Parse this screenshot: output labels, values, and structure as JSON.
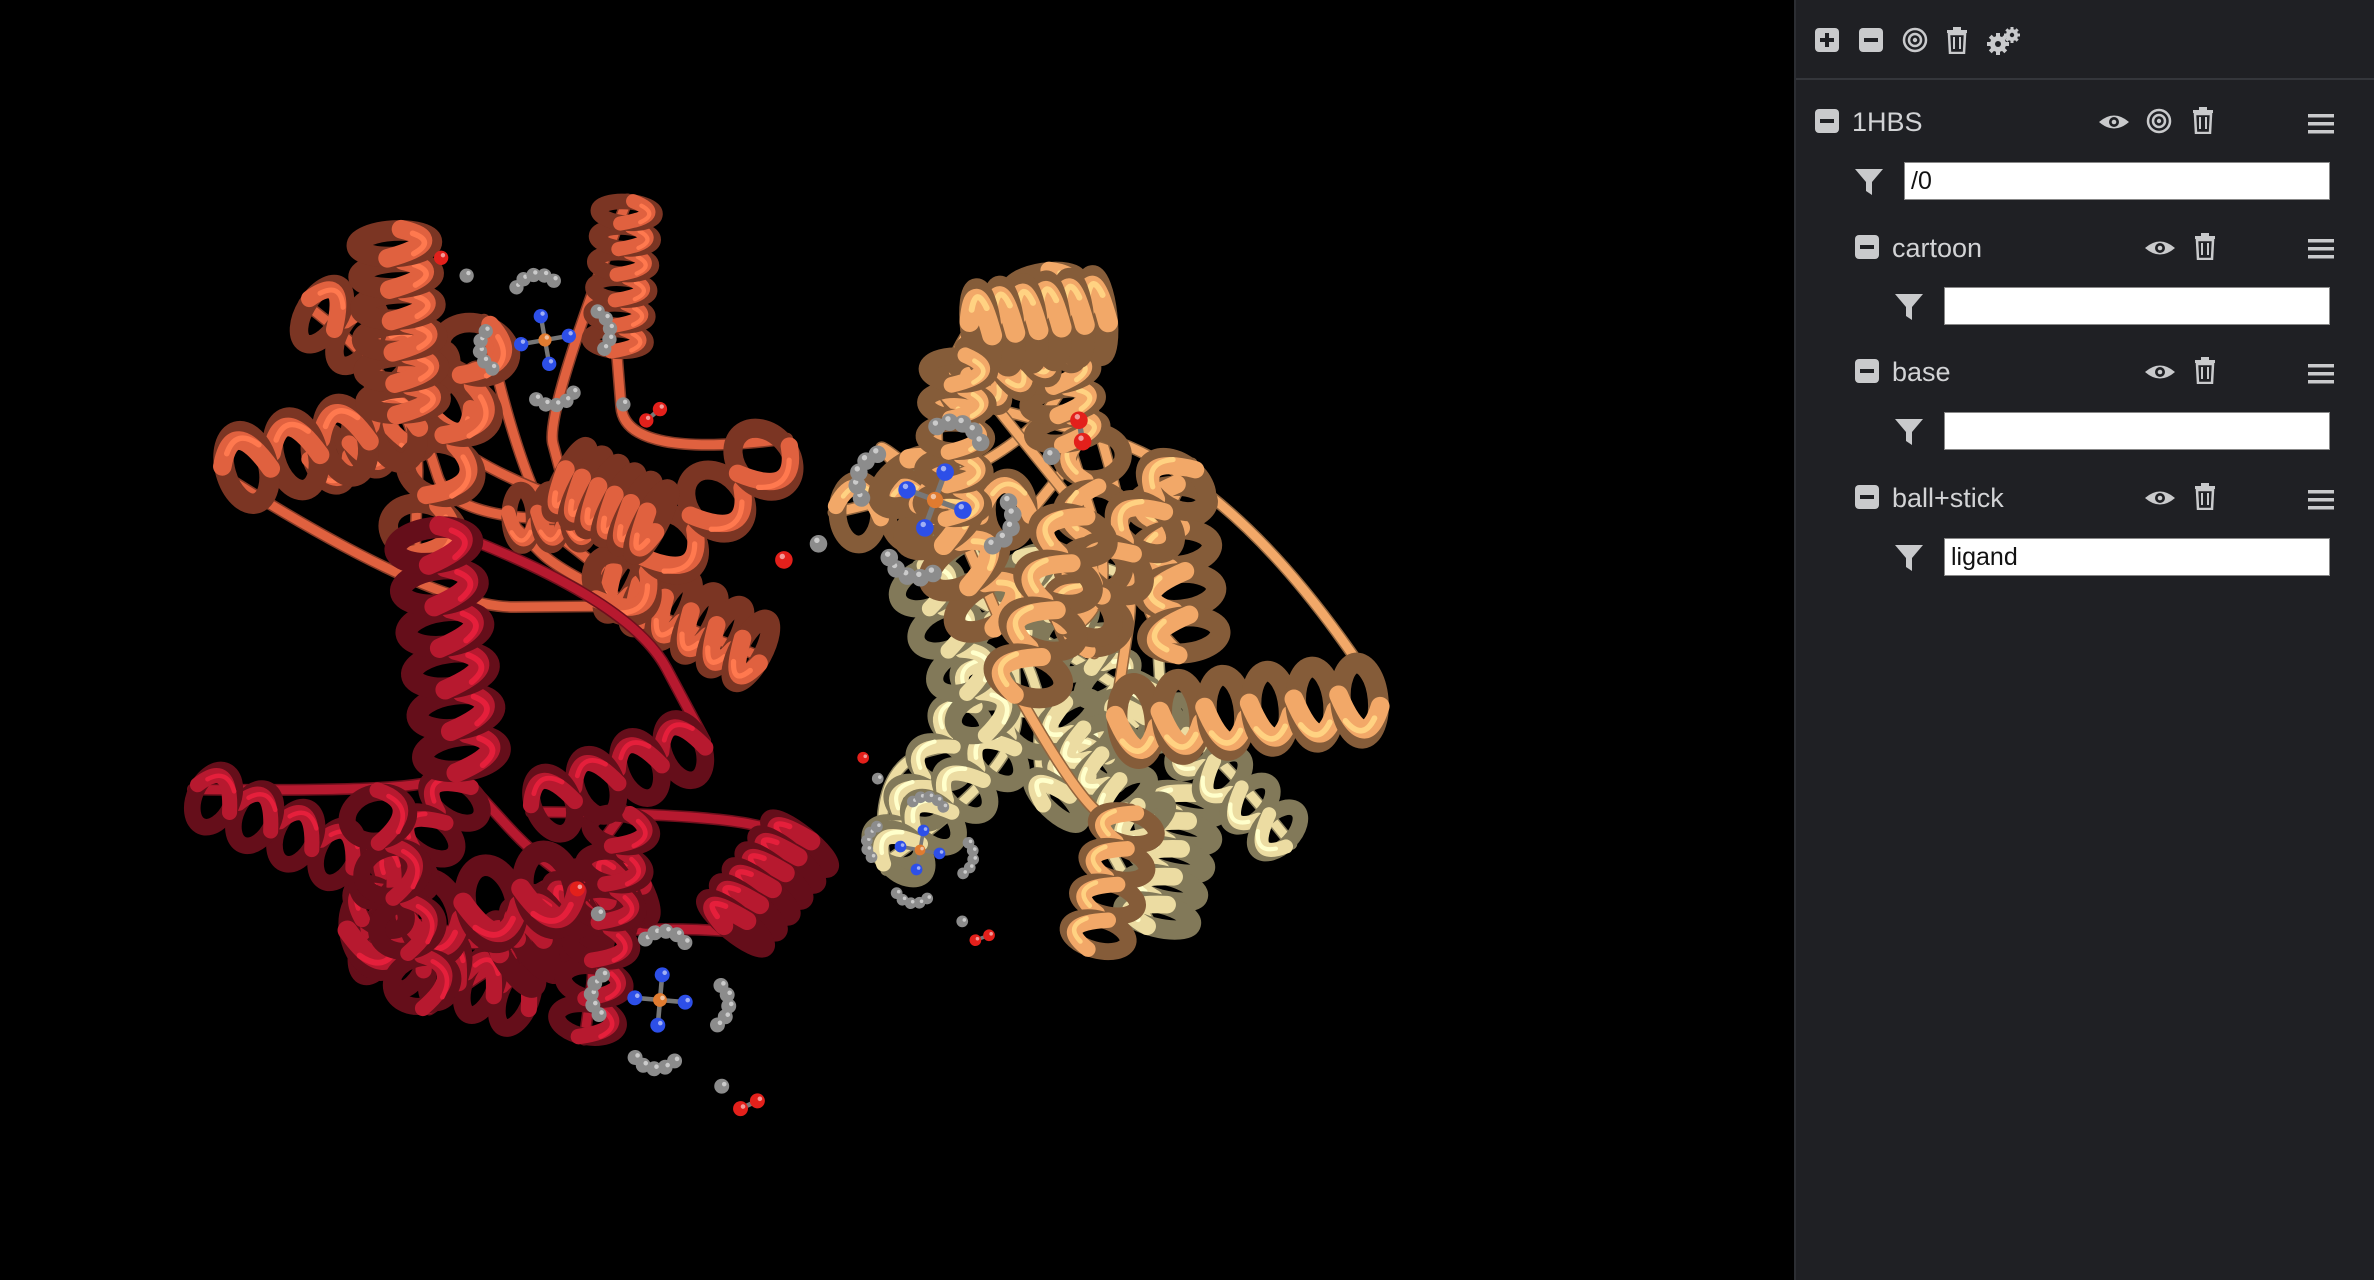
{
  "toolbar": {
    "icons": [
      "add-component-icon",
      "collapse-all-icon",
      "center-icon",
      "delete-all-icon",
      "settings-icon"
    ]
  },
  "component": {
    "name": "1HBS",
    "filter_value": "/0"
  },
  "representations": [
    {
      "name": "cartoon",
      "filter_value": ""
    },
    {
      "name": "base",
      "filter_value": ""
    },
    {
      "name": "ball+stick",
      "filter_value": "ligand"
    }
  ],
  "colors": {
    "panel_background": "#1f2024",
    "viewport_background": "#000000",
    "chain_a": "#e0613f",
    "chain_b": "#f2a868",
    "chain_c": "#b7192f",
    "chain_d": "#ecdca2",
    "ligand_carbon": "#8c8c8c",
    "ligand_nitrogen": "#2d4fe8",
    "ligand_oxygen": "#e3201b",
    "ligand_iron": "#e07b30"
  }
}
